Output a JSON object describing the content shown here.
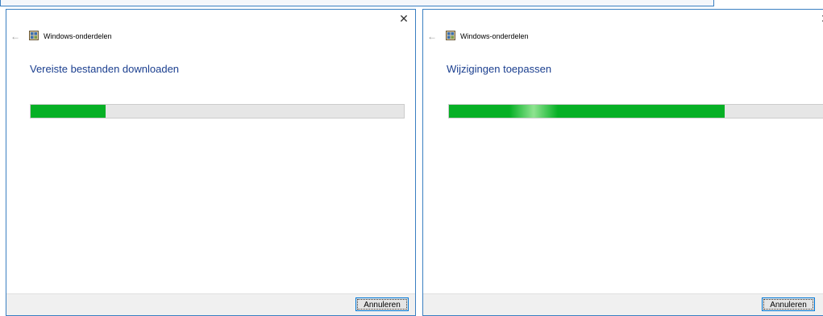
{
  "dialogs": [
    {
      "title": "Windows-onderdelen",
      "heading": "Vereiste bestanden downloaden",
      "progress_fraction": 0.2,
      "close_label": "✕",
      "back_label": "←",
      "cancel_label": "Annuleren"
    },
    {
      "title": "Windows-onderdelen",
      "heading": "Wijzigingen toepassen",
      "progress_fraction": 0.73,
      "close_label": "✕",
      "back_label": "←",
      "cancel_label": "Annuleren"
    }
  ],
  "icons": {
    "back": "back-arrow-icon",
    "app": "windows-features-icon",
    "close": "close-icon"
  },
  "colors": {
    "progress_fill": "#06b025",
    "progress_track": "#e6e6e6",
    "heading": "#1b3f8f",
    "dialog_border": "#3a7fc1"
  }
}
